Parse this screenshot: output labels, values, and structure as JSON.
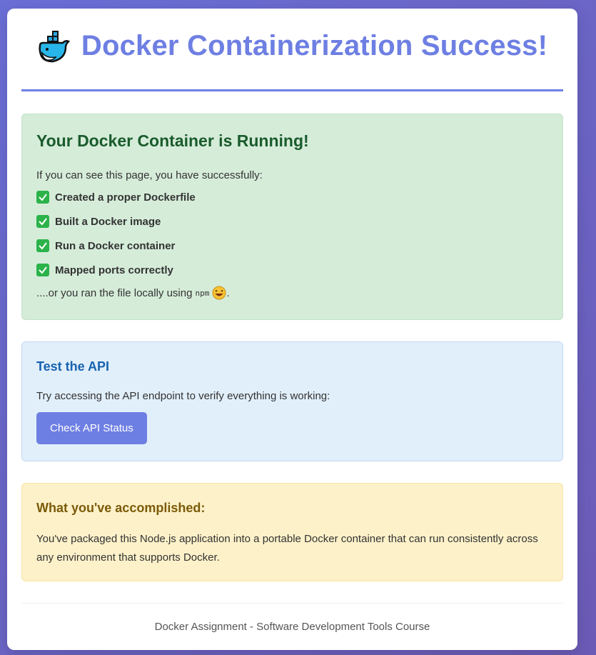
{
  "header": {
    "icon": "whale-icon",
    "title": "Docker Containerization Success!"
  },
  "success_box": {
    "heading": "Your Docker Container is Running!",
    "intro": "If you can see this page, you have successfully:",
    "checklist": [
      "Created a proper Dockerfile",
      "Built a Docker image",
      "Run a Docker container",
      "Mapped ports correctly"
    ],
    "footnote_prefix": "....or you ran the file locally using",
    "footnote_code": "npm",
    "footnote_suffix": "."
  },
  "api_box": {
    "heading": "Test the API",
    "description": "Try accessing the API endpoint to verify everything is working:",
    "button_label": "Check API Status"
  },
  "accomplished_box": {
    "heading": "What you've accomplished:",
    "description": "You've packaged this Node.js application into a portable Docker container that can run consistently across any environment that supports Docker."
  },
  "footer": {
    "text": "Docker Assignment - Software Development Tools Course"
  },
  "colors": {
    "accent": "#6e7fe3",
    "success_bg": "#d5ecd9",
    "info_bg": "#e1effb",
    "warn_bg": "#fdf1c9"
  }
}
